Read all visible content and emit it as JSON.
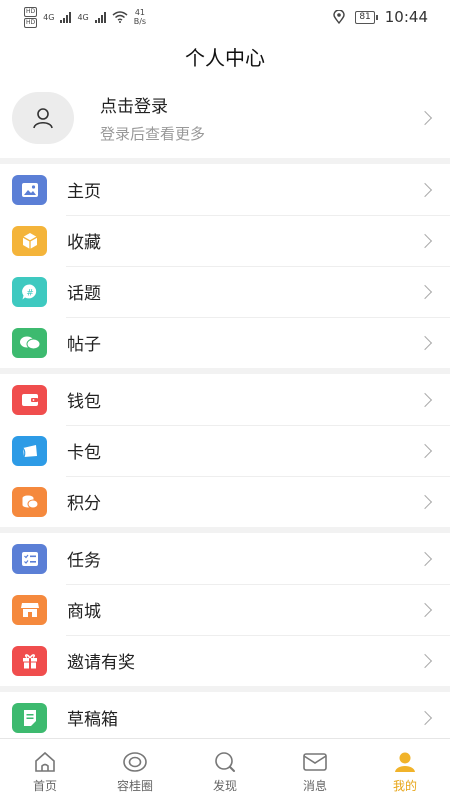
{
  "status_bar": {
    "network_1": "4G",
    "network_2": "4G",
    "speed_value": "41",
    "speed_unit": "B/s",
    "battery": "81",
    "time": "10:44"
  },
  "header": {
    "title": "个人中心"
  },
  "profile": {
    "title": "点击登录",
    "subtitle": "登录后查看更多"
  },
  "groups": [
    {
      "items": [
        {
          "label": "主页",
          "icon": "image-icon",
          "color": "#5b7fd6"
        },
        {
          "label": "收藏",
          "icon": "box-icon",
          "color": "#f4b43a"
        },
        {
          "label": "话题",
          "icon": "hashtag-chat-icon",
          "color": "#3ec9c0"
        },
        {
          "label": "帖子",
          "icon": "chat-bubbles-icon",
          "color": "#3dba6f"
        }
      ]
    },
    {
      "items": [
        {
          "label": "钱包",
          "icon": "wallet-icon",
          "color": "#f04d4d"
        },
        {
          "label": "卡包",
          "icon": "card-icon",
          "color": "#2d9be6"
        },
        {
          "label": "积分",
          "icon": "coins-icon",
          "color": "#f5893d"
        }
      ]
    },
    {
      "items": [
        {
          "label": "任务",
          "icon": "task-list-icon",
          "color": "#5b7fd6"
        },
        {
          "label": "商城",
          "icon": "store-icon",
          "color": "#f5893d"
        },
        {
          "label": "邀请有奖",
          "icon": "gift-icon",
          "color": "#f04d4d"
        }
      ]
    },
    {
      "items": [
        {
          "label": "草稿箱",
          "icon": "draft-icon",
          "color": "#3dba6f"
        }
      ]
    }
  ],
  "tabbar": {
    "tabs": [
      {
        "label": "首页",
        "icon": "home-icon"
      },
      {
        "label": "容桂圈",
        "icon": "circle-icon"
      },
      {
        "label": "发现",
        "icon": "discover-icon"
      },
      {
        "label": "消息",
        "icon": "mail-icon"
      },
      {
        "label": "我的",
        "icon": "person-icon"
      }
    ],
    "active_index": 4,
    "active_color": "#e7a517"
  }
}
